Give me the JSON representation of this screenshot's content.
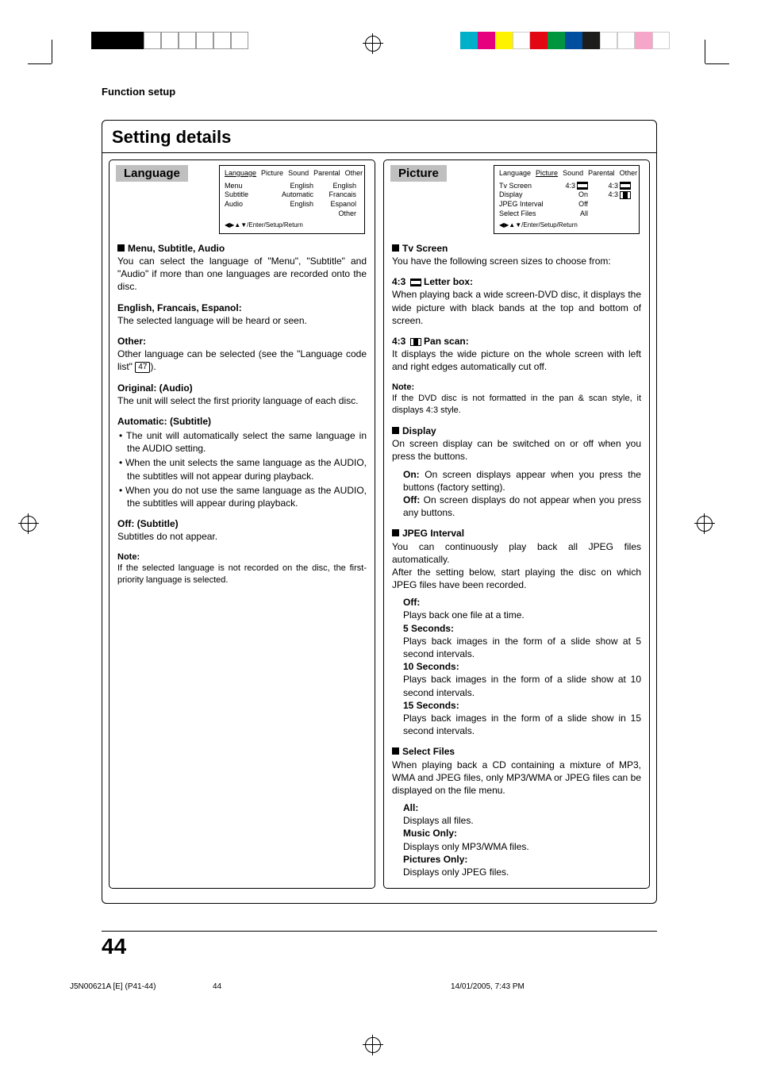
{
  "header": {
    "section": "Function setup"
  },
  "title": "Setting details",
  "pageNumber": "44",
  "footer": {
    "doc": "J5N00621A [E] (P41-44)",
    "page": "44",
    "date": "14/01/2005, 7:43 PM"
  },
  "left": {
    "heading": "Language",
    "osd": {
      "tabs": [
        "Language",
        "Picture",
        "Sound",
        "Parental",
        "Other"
      ],
      "selected": 0,
      "rows": [
        {
          "c1": "Menu",
          "c2": "English",
          "c3": "English"
        },
        {
          "c1": "Subtitle",
          "c2": "Automatic",
          "c3": "Francais"
        },
        {
          "c1": "Audio",
          "c2": "English",
          "c3": "Espanol"
        },
        {
          "c1": "",
          "c2": "",
          "c3": "Other"
        }
      ],
      "foot": "◀▶▲▼/Enter/Setup/Return"
    },
    "s_msa_title": "Menu, Subtitle, Audio",
    "s_msa_body": "You can select the language of \"Menu\", \"Subtitle\" and \"Audio\" if more than one languages are recorded onto the disc.",
    "s_efe_label": "English, Francais, Espanol:",
    "s_efe_body": "The selected language will be heard or seen.",
    "s_other_label": "Other:",
    "s_other_body_a": "Other language can be selected (see the \"Language code list\" ",
    "s_other_pageref": "47",
    "s_other_body_b": ").",
    "s_orig_label": "Original: (Audio)",
    "s_orig_body": "The unit will select the first priority language of each disc.",
    "s_auto_label": "Automatic: (Subtitle)",
    "s_auto_b1": "The unit will automatically select the same language in the AUDIO setting.",
    "s_auto_b2": "When the unit selects the same language as the AUDIO, the subtitles will not appear during playback.",
    "s_auto_b3": "When you do not use the same language as the AUDIO, the subtitles will appear during playback.",
    "s_off_label": "Off: (Subtitle)",
    "s_off_body": "Subtitles do not appear.",
    "note_label": "Note:",
    "note_body": "If the selected language is not recorded on the disc, the first-priority language is selected."
  },
  "right": {
    "heading": "Picture",
    "osd": {
      "tabs": [
        "Language",
        "Picture",
        "Sound",
        "Parental",
        "Other"
      ],
      "selected": 1,
      "rows": [
        {
          "c1": "Tv Screen",
          "c2": "4:3",
          "c2icon": "lb",
          "c3": "4:3",
          "c3icon": "lb"
        },
        {
          "c1": "Display",
          "c2": "On",
          "c3": "4:3",
          "c3icon": "ps"
        },
        {
          "c1": "JPEG Interval",
          "c2": "Off",
          "c3": ""
        },
        {
          "c1": "Select Files",
          "c2": "All",
          "c3": ""
        }
      ],
      "foot": "◀▶▲▼/Enter/Setup/Return"
    },
    "tv_title": "Tv Screen",
    "tv_intro": "You have the following screen sizes to choose from:",
    "lb_label": "4:3",
    "lb_suffix": "Letter box:",
    "lb_body": "When playing back a wide screen-DVD disc, it displays the wide picture with black bands at the top and bottom of screen.",
    "ps_label": "4:3",
    "ps_suffix": "Pan scan:",
    "ps_body": "It displays the wide picture on the whole screen with left and right edges automatically cut off.",
    "tv_note_label": "Note:",
    "tv_note_body": "If the DVD disc is not formatted in the pan & scan style, it displays 4:3 style.",
    "disp_title": "Display",
    "disp_body": "On screen display can be switched on or off when you press the buttons.",
    "disp_on_label": "On:",
    "disp_on_body": "On screen displays appear when you press the buttons (factory setting).",
    "disp_off_label": "Off:",
    "disp_off_body": "On screen displays do not appear when you press any buttons.",
    "jpeg_title": "JPEG Interval",
    "jpeg_intro1": "You can continuously play back all JPEG files automatically.",
    "jpeg_intro2": "After the setting below, start playing the disc on which JPEG files have been recorded.",
    "jpeg_off_label": "Off:",
    "jpeg_off_body": "Plays back one file at a time.",
    "jpeg_5_label": "5 Seconds:",
    "jpeg_5_body": "Plays back images in the form of a slide show at 5 second intervals.",
    "jpeg_10_label": "10 Seconds:",
    "jpeg_10_body": "Plays back images in the form of a slide show at 10 second intervals.",
    "jpeg_15_label": "15 Seconds:",
    "jpeg_15_body": "Plays back images in the form of a slide show in 15 second intervals.",
    "sf_title": "Select Files",
    "sf_body": "When playing back a CD containing a mixture of MP3, WMA and JPEG files, only MP3/WMA or JPEG files can be displayed on the file menu.",
    "sf_all_label": "All:",
    "sf_all_body": "Displays all files.",
    "sf_mus_label": "Music Only:",
    "sf_mus_body": "Displays only MP3/WMA files.",
    "sf_pic_label": "Pictures Only:",
    "sf_pic_body": "Displays only JPEG files."
  }
}
